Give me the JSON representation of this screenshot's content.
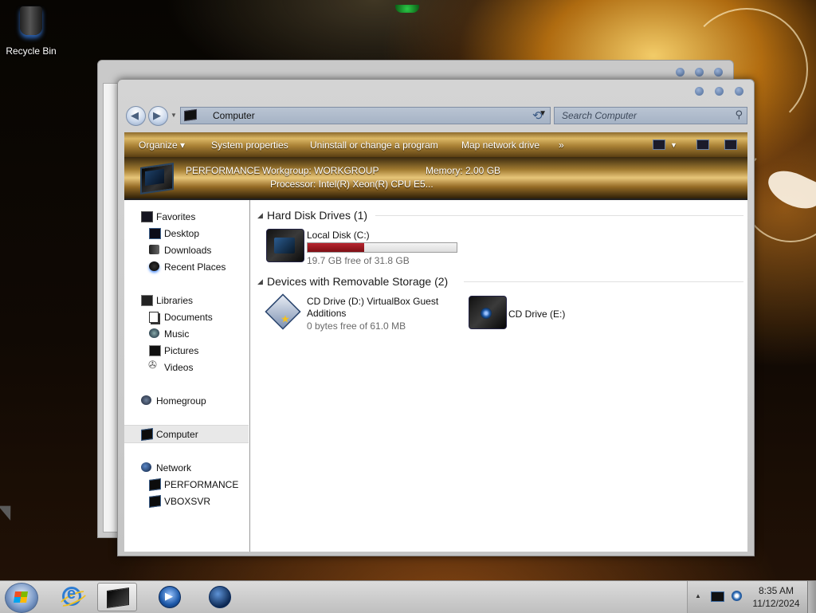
{
  "desktop": {
    "recycle_bin_label": "Recycle Bin"
  },
  "window": {
    "address": "Computer",
    "search_placeholder": "Search Computer",
    "toolbar": {
      "organize": "Organize ▾",
      "system_properties": "System properties",
      "uninstall": "Uninstall or change a program",
      "map_drive": "Map network drive",
      "more": "»"
    },
    "details": {
      "computer_name": "PERFORMANCE",
      "workgroup": "Workgroup: WORKGROUP",
      "memory": "Memory: 2.00 GB",
      "processor": "Processor: Intel(R) Xeon(R) CPU E5..."
    },
    "nav": {
      "favorites": "Favorites",
      "desktop": "Desktop",
      "downloads": "Downloads",
      "recent_places": "Recent Places",
      "libraries": "Libraries",
      "documents": "Documents",
      "music": "Music",
      "pictures": "Pictures",
      "videos": "Videos",
      "homegroup": "Homegroup",
      "computer": "Computer",
      "network": "Network",
      "net_performance": "PERFORMANCE",
      "net_vboxsvr": "VBOXSVR"
    },
    "groups": {
      "hdd": {
        "title": "Hard Disk Drives (1)",
        "drives": [
          {
            "name": "Local Disk (C:)",
            "free_text": "19.7 GB free of 31.8 GB",
            "used_fraction": 0.38
          }
        ]
      },
      "removable": {
        "title": "Devices with Removable Storage (2)",
        "drives": [
          {
            "name_line1": "CD Drive (D:) VirtualBox Guest",
            "name_line2": "Additions",
            "free_text": "0 bytes free of 61.0 MB"
          },
          {
            "name": "CD Drive (E:)"
          }
        ]
      }
    }
  },
  "taskbar": {
    "time": "8:35 AM",
    "date": "11/12/2024",
    "tray_arrow": "▲"
  },
  "colors": {
    "usage_bar": "#9e1a22",
    "toolbar_gold": "#dcb866"
  }
}
